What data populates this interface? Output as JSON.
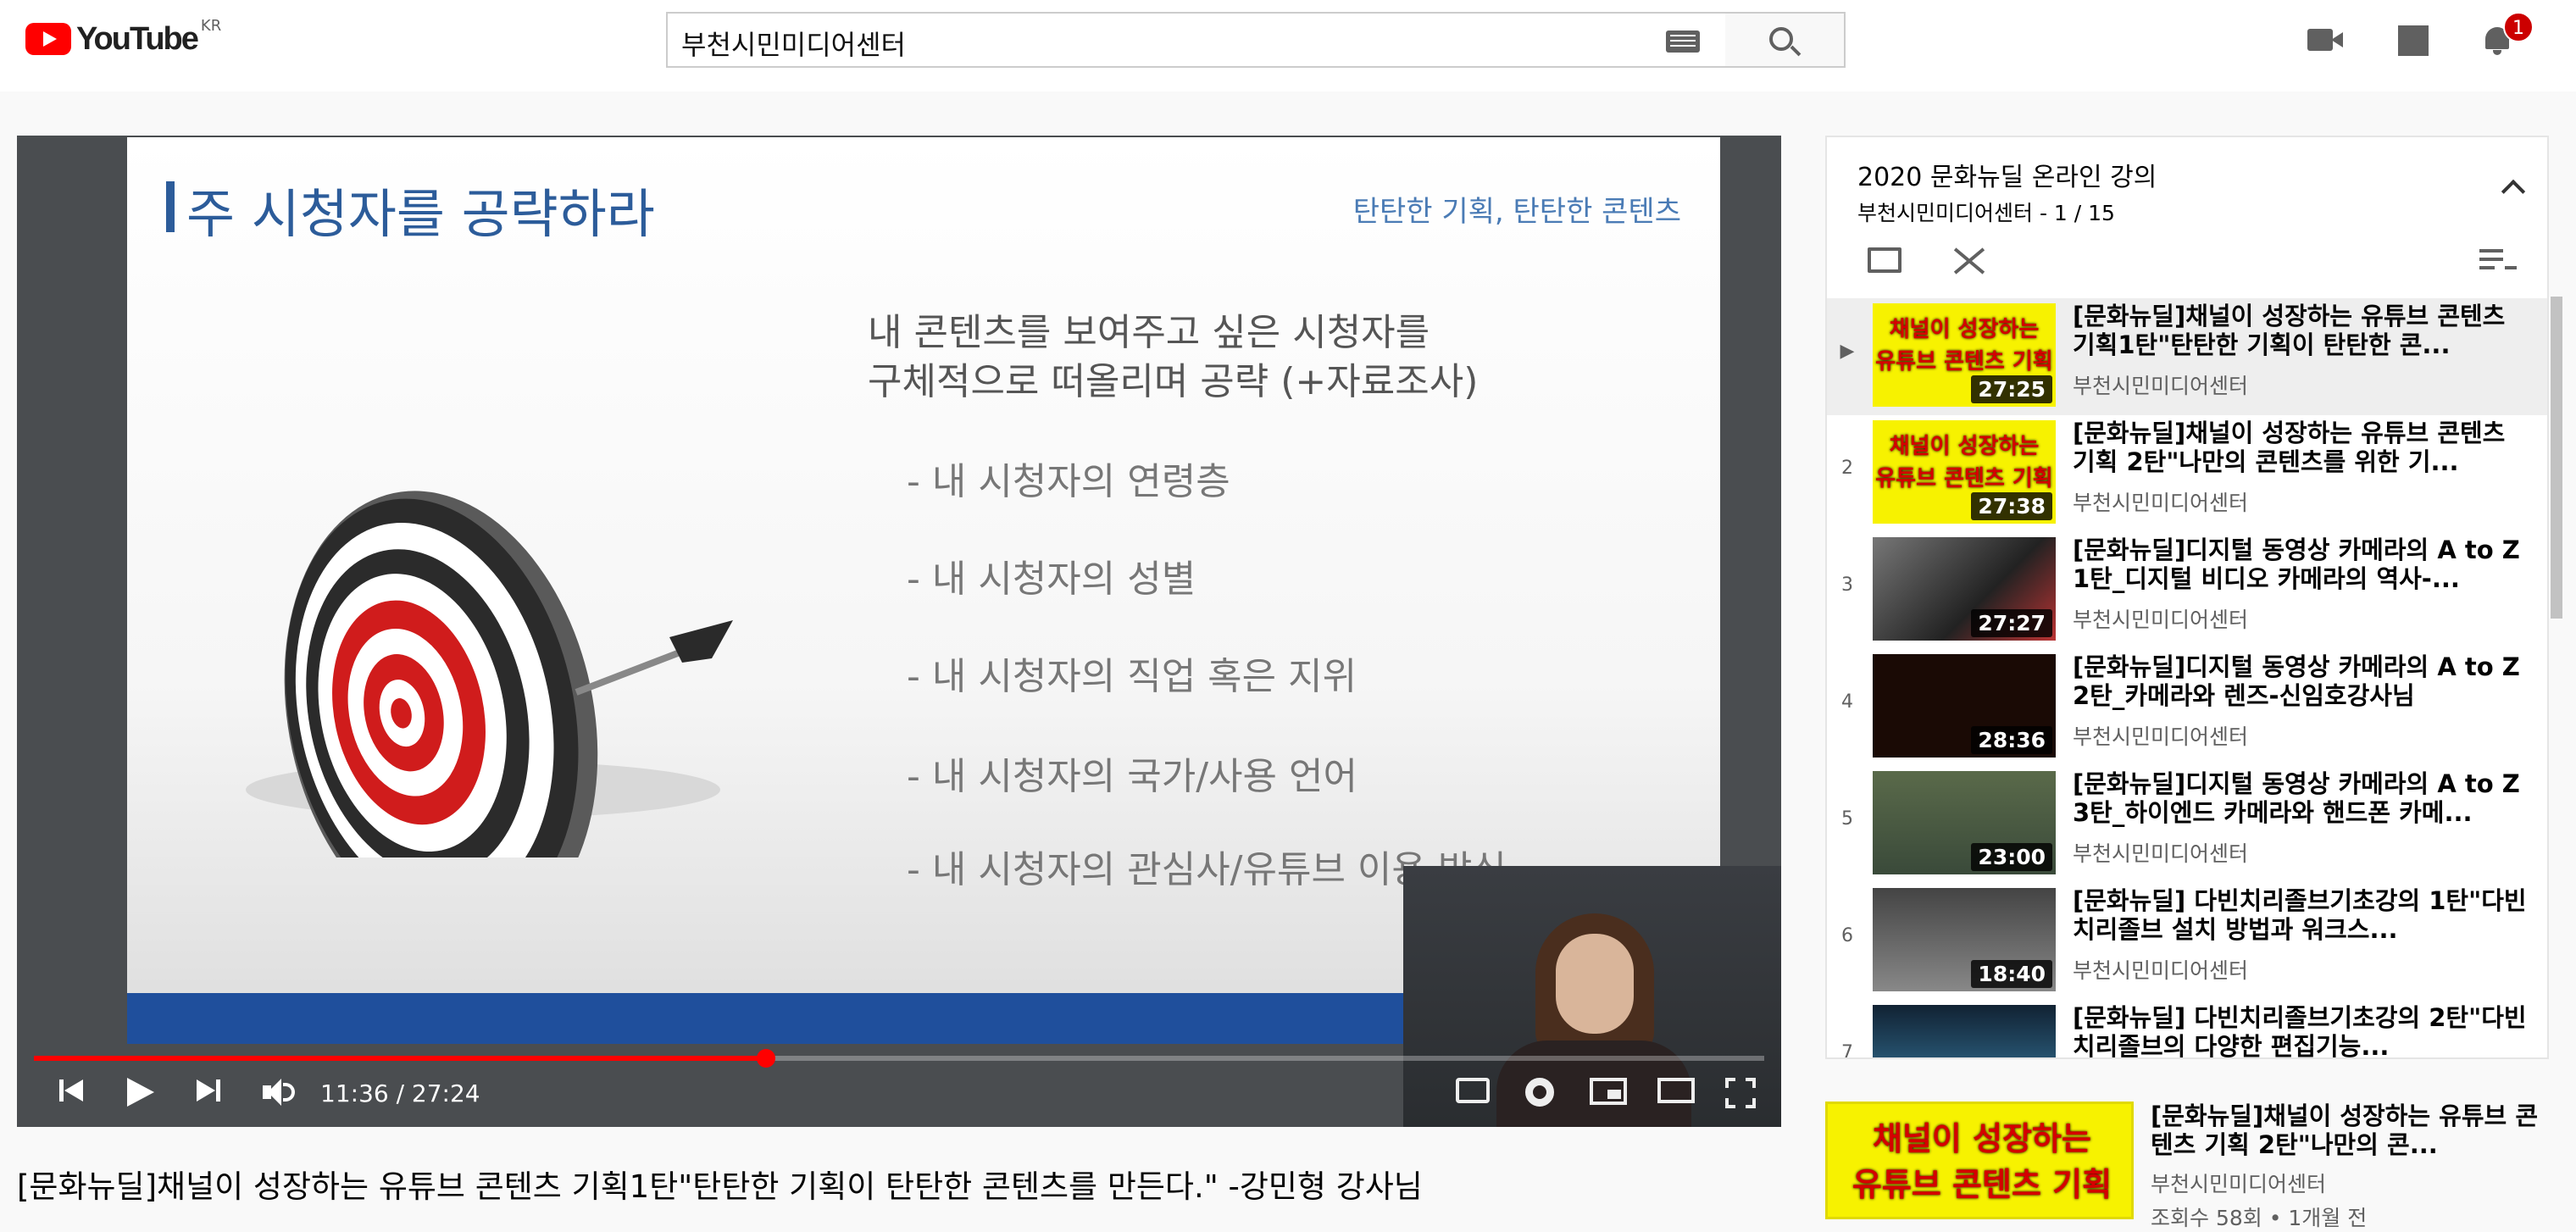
{
  "header": {
    "logo_text": "YouTube",
    "country": "KR",
    "search_value": "부천시민미디어센터",
    "notification_count": "1"
  },
  "player": {
    "slide_title": "주 시청자를 공략하라",
    "slide_subtitle": "탄탄한 기획, 탄탄한 콘텐츠",
    "slide_line1": "내 콘텐츠를 보여주고 싶은 시청자를",
    "slide_line2": "구체적으로 떠올리며 공략 (+자료조사)",
    "bullets": [
      "-   내 시청자의 연령층",
      "-   내 시청자의 성별",
      "-   내 시청자의 직업 혹은 지위",
      "-  내 시청자의 국가/사용 언어",
      "-  내 시청자의 관심사/유튜브 이용 방식"
    ],
    "time": "11:36 / 27:24",
    "progress": 0.423
  },
  "video_title": "[문화뉴딜]채널이 성장하는 유튜브 콘텐츠 기획1탄\"탄탄한 기획이 탄탄한 콘텐츠를 만든다.\" -강민형 강사님",
  "playlist": {
    "title": "2020 문화뉴딜 온라인 강의",
    "meta": "부천시민미디어센터 - 1 / 15",
    "items": [
      {
        "index": "▶",
        "title": "[문화뉴딜]채널이 성장하는 유튜브 콘텐츠 기획1탄\"탄탄한 기획이 탄탄한 콘...",
        "channel": "부천시민미디어센터",
        "duration": "27:25"
      },
      {
        "index": "2",
        "title": "[문화뉴딜]채널이 성장하는 유튜브 콘텐츠 기획 2탄\"나만의 콘텐츠를 위한 기...",
        "channel": "부천시민미디어센터",
        "duration": "27:38"
      },
      {
        "index": "3",
        "title": "[문화뉴딜]디지털 동영상 카메라의 A to Z 1탄_디지털 비디오 카메라의 역사-...",
        "channel": "부천시민미디어센터",
        "duration": "27:27"
      },
      {
        "index": "4",
        "title": "[문화뉴딜]디지털 동영상 카메라의 A to Z 2탄_카메라와 렌즈-신임호강사님",
        "channel": "부천시민미디어센터",
        "duration": "28:36"
      },
      {
        "index": "5",
        "title": "[문화뉴딜]디지털 동영상 카메라의 A to Z 3탄_하이엔드 카메라와 핸드폰 카메...",
        "channel": "부천시민미디어센터",
        "duration": "23:00"
      },
      {
        "index": "6",
        "title": "[문화뉴딜] 다빈치리졸브기초강의 1탄\"다빈치리졸브 설치 방법과 워크스...",
        "channel": "부천시민미디어센터",
        "duration": "18:40"
      },
      {
        "index": "7",
        "title": "[문화뉴딜] 다빈치리졸브기초강의 2탄\"다빈치리졸브의 다양한 편집기능...",
        "channel": "부천시민미디어센터",
        "duration": ""
      }
    ],
    "thumb_line1": "채널이 성장하는",
    "thumb_line2": "유튜브 콘텐츠 기획"
  },
  "recommendation": {
    "title": "[문화뉴딜]채널이 성장하는 유튜브 콘텐츠 기획 2탄\"나만의 콘...",
    "channel": "부천시민미디어센터",
    "views": "조회수 58회 • 1개월 전",
    "thumb_line1": "채널이 성장하는",
    "thumb_line2": "유튜브 콘텐츠 기획"
  },
  "colors": {
    "brand_red": "#ff0000",
    "slide_blue": "#2c5c9a",
    "badge_red": "#cc0000"
  }
}
